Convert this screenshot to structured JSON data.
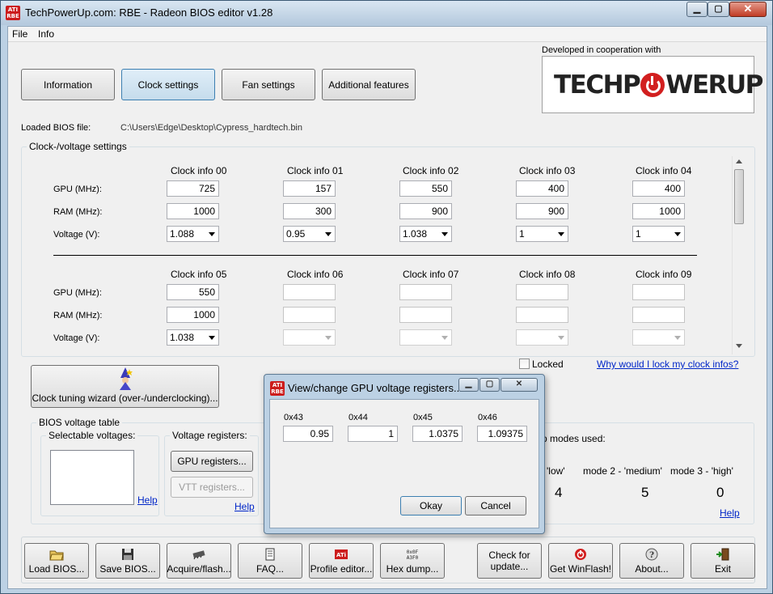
{
  "window": {
    "title": "TechPowerUp.com: RBE - Radeon BIOS editor v1.28",
    "logo_text": "ATI RBE",
    "caption_minimize": "▁",
    "caption_maximize": "▢",
    "caption_close": "✕"
  },
  "menu": [
    "File",
    "Info"
  ],
  "tabs": [
    {
      "label": "Information"
    },
    {
      "label": "Clock settings"
    },
    {
      "label": "Fan settings"
    },
    {
      "label": "Additional features"
    }
  ],
  "branding": {
    "cooperation_text": "Developed in cooperation with",
    "logo_left": "TECHP",
    "logo_right": "WERUP"
  },
  "bios_file": {
    "label": "Loaded BIOS file:",
    "path": "C:\\Users\\Edge\\Desktop\\Cypress_hardtech.bin"
  },
  "clock_group": {
    "title": "Clock-/voltage settings",
    "row_labels": {
      "gpu": "GPU (MHz):",
      "ram": "RAM (MHz):",
      "voltage": "Voltage (V):"
    },
    "row1": [
      {
        "header": "Clock info 00",
        "gpu": "725",
        "ram": "1000",
        "voltage": "1.088"
      },
      {
        "header": "Clock info 01",
        "gpu": "157",
        "ram": "300",
        "voltage": "0.95"
      },
      {
        "header": "Clock info 02",
        "gpu": "550",
        "ram": "900",
        "voltage": "1.038"
      },
      {
        "header": "Clock info 03",
        "gpu": "400",
        "ram": "900",
        "voltage": "1"
      },
      {
        "header": "Clock info 04",
        "gpu": "400",
        "ram": "1000",
        "voltage": "1"
      }
    ],
    "row2": [
      {
        "header": "Clock info 05",
        "gpu": "550",
        "ram": "1000",
        "voltage": "1.038"
      },
      {
        "header": "Clock info 06",
        "gpu": "",
        "ram": "",
        "voltage": ""
      },
      {
        "header": "Clock info 07",
        "gpu": "",
        "ram": "",
        "voltage": ""
      },
      {
        "header": "Clock info 08",
        "gpu": "",
        "ram": "",
        "voltage": ""
      },
      {
        "header": "Clock info 09",
        "gpu": "",
        "ram": "",
        "voltage": ""
      }
    ],
    "locked_label": "Locked",
    "locked_checked": false,
    "lock_link": "Why would I lock my clock infos?"
  },
  "wizard_button": "Clock tuning wizard (over-/underclocking)...",
  "voltage_table": {
    "title": "BIOS voltage table",
    "selectable_title": "Selectable voltages:",
    "help": "Help",
    "registers_title": "Voltage registers:",
    "gpu_registers_button": "GPU registers...",
    "vtt_registers_button": "VTT registers...",
    "registers_help": "Help"
  },
  "modes": {
    "title_fragment": "p modes used:",
    "mode1_label": "'low'",
    "mode1_value": "4",
    "mode2_label": "mode 2 - 'medium'",
    "mode2_value": "5",
    "mode3_label": "mode 3 - 'high'",
    "mode3_value": "0",
    "help": "Help"
  },
  "toolbar": [
    {
      "label": "Load BIOS...",
      "icon": "open-folder-icon"
    },
    {
      "label": "Save BIOS...",
      "icon": "floppy-disk-icon"
    },
    {
      "label": "Acquire/flash...",
      "icon": "chip-icon"
    },
    {
      "label": "FAQ...",
      "icon": "document-icon"
    },
    {
      "label": "Profile editor...",
      "icon": "ati-logo-icon"
    },
    {
      "label": "Hex dump...",
      "icon": "hex-icon"
    },
    {
      "label": "Check for update...",
      "icon": ""
    },
    {
      "label": "Get WinFlash!",
      "icon": "power-icon"
    },
    {
      "label": "About...",
      "icon": "info-icon"
    },
    {
      "label": "Exit",
      "icon": "exit-door-icon"
    }
  ],
  "dialog": {
    "title": "View/change GPU voltage registers...",
    "registers": [
      {
        "name": "0x43",
        "value": "0.95"
      },
      {
        "name": "0x44",
        "value": "1"
      },
      {
        "name": "0x45",
        "value": "1.0375"
      },
      {
        "name": "0x46",
        "value": "1.09375"
      }
    ],
    "okay_button": "Okay",
    "cancel_button": "Cancel"
  }
}
